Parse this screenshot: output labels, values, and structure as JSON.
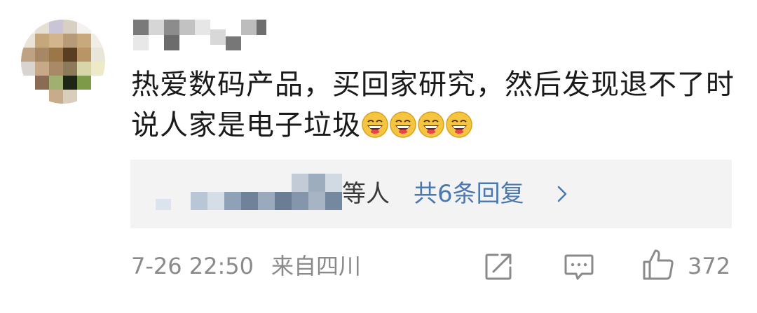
{
  "comment": {
    "text": "热爱数码产品，买回家研究，然后发现退不了时说人家是电子垃圾",
    "emoji_count": 4,
    "emoji_name": "laughing-face-emoji"
  },
  "replies": {
    "suffix": "等人",
    "count_label": "共6条回复"
  },
  "footer": {
    "timestamp": "7-26 22:50",
    "location": "来自四川",
    "like_count": "372"
  },
  "colors": {
    "link": "#4a78b0",
    "meta": "#8a8a8a",
    "text": "#1a1a1a",
    "reply_bg": "#f3f3f3"
  }
}
